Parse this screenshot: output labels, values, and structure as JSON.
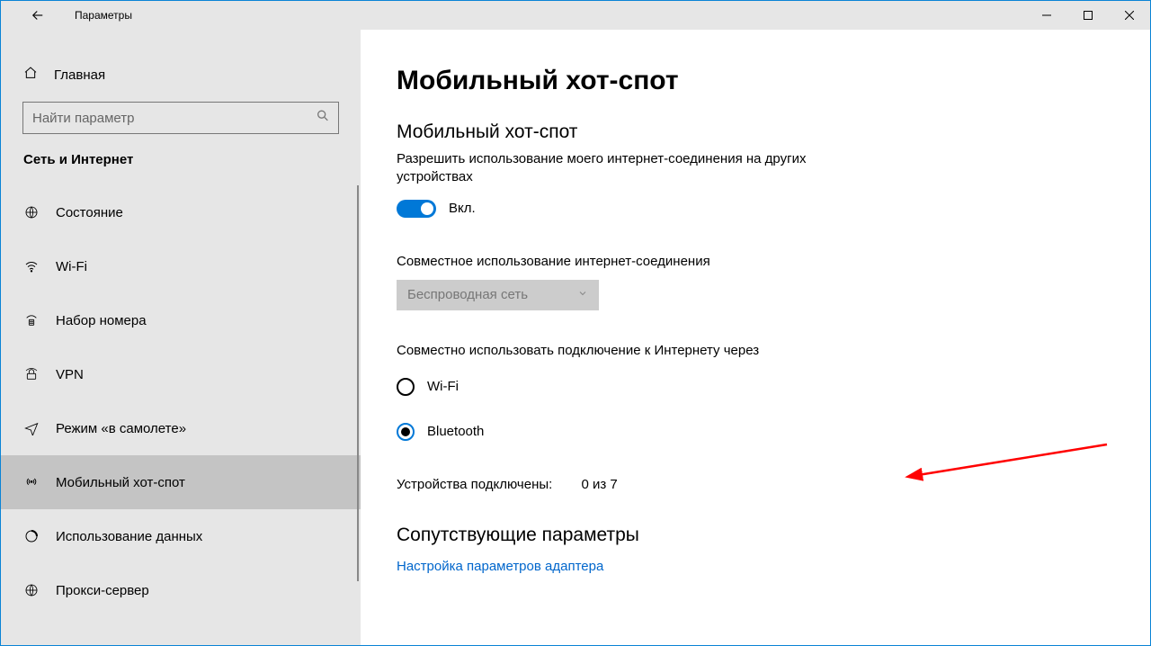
{
  "titlebar": {
    "title": "Параметры"
  },
  "sidebar": {
    "home_label": "Главная",
    "search_placeholder": "Найти параметр",
    "section_title": "Сеть и Интернет",
    "items": [
      {
        "label": "Состояние"
      },
      {
        "label": "Wi-Fi"
      },
      {
        "label": "Набор номера"
      },
      {
        "label": "VPN"
      },
      {
        "label": "Режим «в самолете»"
      },
      {
        "label": "Мобильный хот-спот"
      },
      {
        "label": "Использование данных"
      },
      {
        "label": "Прокси-сервер"
      }
    ],
    "active_index": 5
  },
  "main": {
    "page_title": "Мобильный хот-спот",
    "hotspot_heading": "Мобильный хот-спот",
    "hotspot_desc": "Разрешить использование моего интернет-соединения на других устройствах",
    "toggle_state_label": "Вкл.",
    "share_connection_label": "Совместное использование интернет-соединения",
    "share_connection_value": "Беспроводная сеть",
    "share_via_label": "Совместно использовать подключение к Интернету через",
    "radio_options": [
      {
        "label": "Wi-Fi"
      },
      {
        "label": "Bluetooth"
      }
    ],
    "radio_selected_index": 1,
    "devices_label": "Устройства подключены:",
    "devices_value": "0 из 7",
    "related_heading": "Сопутствующие параметры",
    "adapter_link": "Настройка параметров адаптера"
  }
}
